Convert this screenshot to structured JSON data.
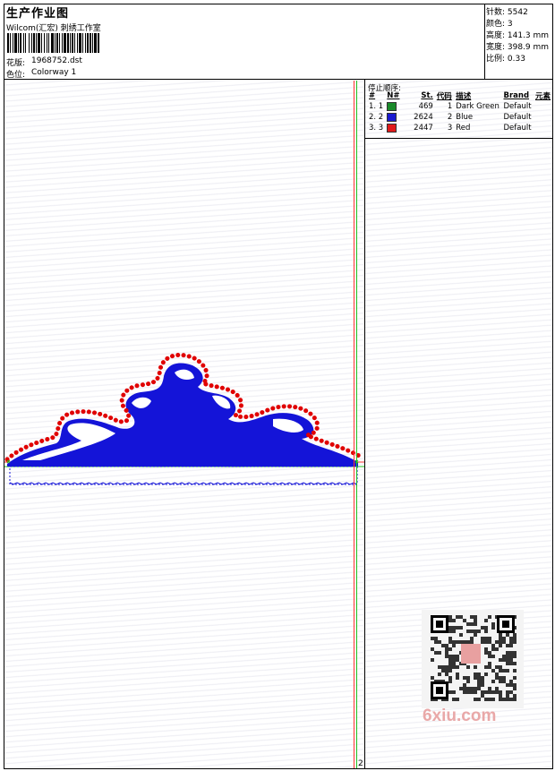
{
  "header": {
    "title": "生产作业图",
    "company": "Wilcom(汇宏) 刺绣工作室",
    "design_label": "花版:",
    "design_value": "1968752.dst",
    "colorway_label": "色位:",
    "colorway_value": "Colorway 1"
  },
  "stats": {
    "stitches": "针数: 5542",
    "colors": "颜色: 3",
    "height": "高度: 141.3 mm",
    "width": "宽度: 398.9 mm",
    "scale": "比例: 0.33"
  },
  "sequence": {
    "heading": "停止顺序:",
    "columns": [
      "#",
      "N#",
      "St.",
      "代码",
      "描述",
      "Brand",
      "元素"
    ],
    "rows": [
      {
        "num": "1. 1",
        "color": "#1a8a2a",
        "stitches": "469",
        "code": "1",
        "desc": "Dark Green",
        "brand": "Default"
      },
      {
        "num": "2. 2",
        "color": "#1a1ad0",
        "stitches": "2624",
        "code": "2",
        "desc": "Blue",
        "brand": "Default"
      },
      {
        "num": "3. 3",
        "color": "#e01a1a",
        "stitches": "2447",
        "code": "3",
        "desc": "Red",
        "brand": "Default"
      }
    ]
  },
  "page_number": "2",
  "watermark": "6xiu.com",
  "colors": {
    "red": "#e00000",
    "blue": "#1414d8",
    "green": "#1a8a2a",
    "guide_red": "#ff3030",
    "guide_green": "#20c020"
  }
}
